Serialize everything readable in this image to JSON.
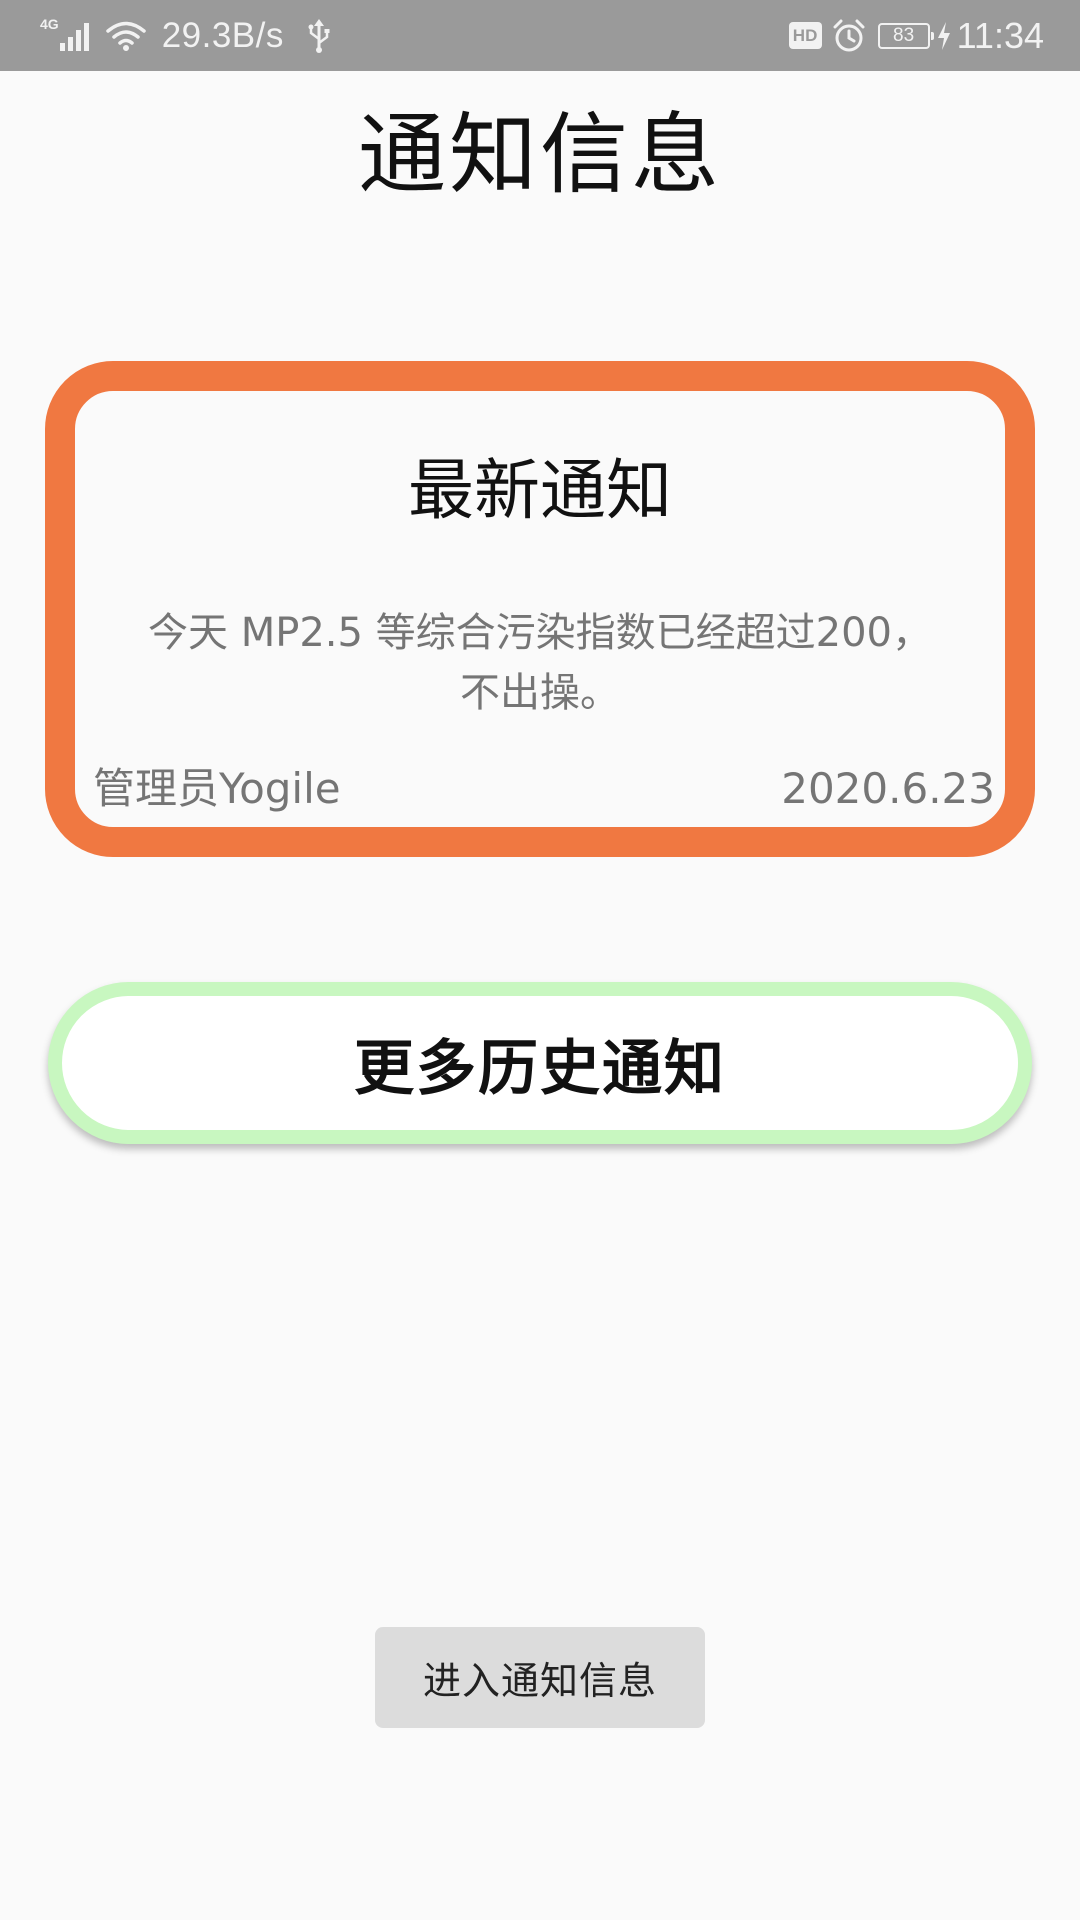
{
  "status_bar": {
    "network_type": "4G",
    "speed": "29.3B/s",
    "hd": "HD",
    "battery": "83",
    "time": "11:34",
    "icons": [
      "signal-icon",
      "wifi-icon",
      "usb-icon",
      "hd-icon",
      "alarm-icon",
      "battery-icon",
      "charge-icon"
    ]
  },
  "page": {
    "title": "通知信息"
  },
  "latest_notice": {
    "heading": "最新通知",
    "body_line1": "今天 MP2.5 等综合污染指数已经超过200，",
    "body_line2": "不出操。",
    "author": "管理员Yogile",
    "date": "2020.6.23",
    "border_color": "#f07841"
  },
  "history_button": {
    "label": "更多历史通知",
    "border_color": "#c8f7c0"
  },
  "enter_button": {
    "label": "进入通知信息"
  }
}
